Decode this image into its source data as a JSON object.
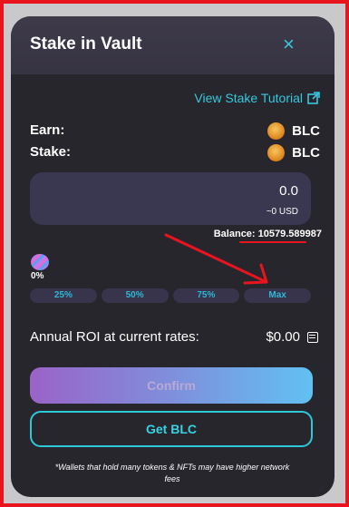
{
  "modal": {
    "title": "Stake in Vault",
    "close_symbol": "×",
    "tutorial_link": "View Stake Tutorial",
    "earn": {
      "label": "Earn:",
      "token": "BLC"
    },
    "stake": {
      "label": "Stake:",
      "token": "BLC"
    },
    "amount": {
      "value": "0.0",
      "usd": "~0 USD"
    },
    "balance": "Balance: 10579.589987",
    "slider": {
      "percent": "0%",
      "buttons": [
        "25%",
        "50%",
        "75%",
        "Max"
      ]
    },
    "roi": {
      "label": "Annual ROI at current rates:",
      "value": "$0.00"
    },
    "confirm_label": "Confirm",
    "get_label": "Get BLC",
    "note": "*Wallets that hold many tokens & NFTs may have higher network fees"
  },
  "colors": {
    "accent": "#36c9de",
    "annotation": "#e8141e",
    "modal_bg": "#27262c",
    "header_bg": "#3e3a49"
  },
  "icons": [
    "close-icon",
    "external-link-icon",
    "blc-token-icon",
    "calculator-icon"
  ]
}
